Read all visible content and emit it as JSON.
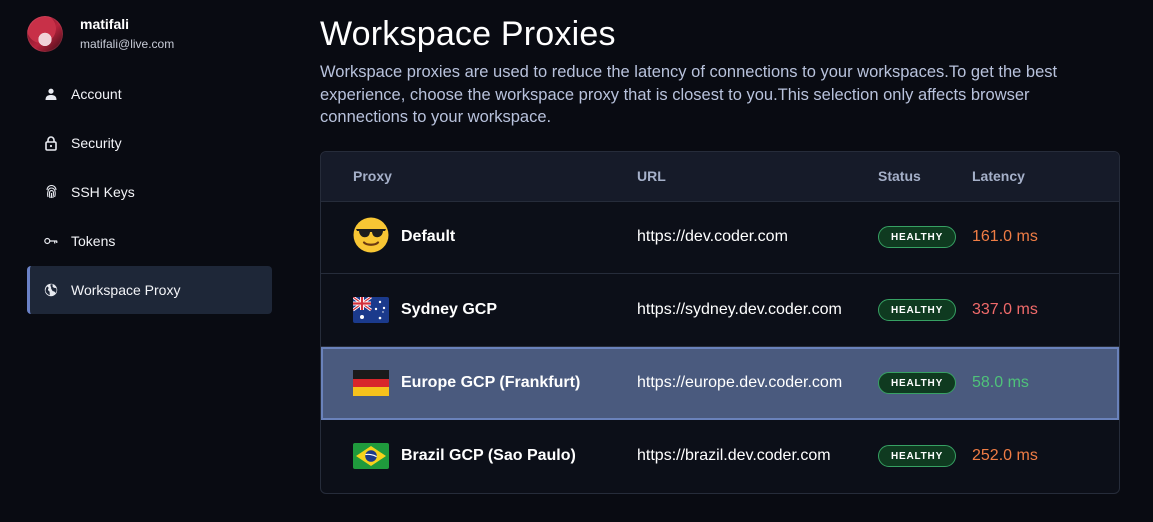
{
  "user": {
    "name": "matifali",
    "email": "matifali@live.com"
  },
  "nav": {
    "items": [
      {
        "label": "Account",
        "icon": "person-icon"
      },
      {
        "label": "Security",
        "icon": "lock-icon"
      },
      {
        "label": "SSH Keys",
        "icon": "fingerprint-icon"
      },
      {
        "label": "Tokens",
        "icon": "key-icon"
      },
      {
        "label": "Workspace Proxy",
        "icon": "globe-icon",
        "active": true
      }
    ]
  },
  "page": {
    "title": "Workspace Proxies",
    "description": "Workspace proxies are used to reduce the latency of connections to your workspaces.To get the best experience, choose the workspace proxy that is closest to you.This selection only affects browser connections to your workspace."
  },
  "table": {
    "headers": {
      "proxy": "Proxy",
      "url": "URL",
      "status": "Status",
      "latency": "Latency"
    },
    "rows": [
      {
        "name": "Default",
        "icon": "sunglasses-emoji-icon",
        "url": "https://dev.coder.com",
        "status": "HEALTHY",
        "latency": "161.0 ms",
        "latency_color": "#f07d45"
      },
      {
        "name": "Sydney GCP",
        "icon": "australia-flag-icon",
        "url": "https://sydney.dev.coder.com",
        "status": "HEALTHY",
        "latency": "337.0 ms",
        "latency_color": "#f06a6a"
      },
      {
        "name": "Europe GCP (Frankfurt)",
        "icon": "germany-flag-icon",
        "url": "https://europe.dev.coder.com",
        "status": "HEALTHY",
        "latency": "58.0 ms",
        "latency_color": "#4fc27a",
        "selected": true
      },
      {
        "name": "Brazil GCP (Sao Paulo)",
        "icon": "brazil-flag-icon",
        "url": "https://brazil.dev.coder.com",
        "status": "HEALTHY",
        "latency": "252.0 ms",
        "latency_color": "#f07d45"
      }
    ]
  },
  "colors": {
    "background": "#090b12",
    "accent": "#6b82c7",
    "healthy": "#37a163"
  }
}
